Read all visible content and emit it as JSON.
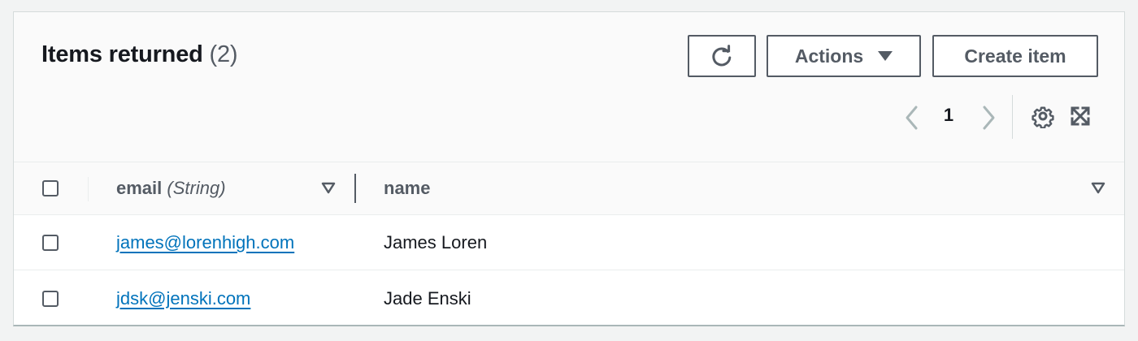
{
  "header": {
    "title": "Items returned",
    "count": "(2)"
  },
  "toolbar": {
    "refresh_icon": "refresh-icon",
    "actions_label": "Actions",
    "create_label": "Create item"
  },
  "pagination": {
    "current_page": "1",
    "prev_icon": "chevron-left-icon",
    "next_icon": "chevron-right-icon",
    "settings_icon": "gear-icon",
    "fullscreen_icon": "expand-icon"
  },
  "table": {
    "columns": [
      {
        "label": "email",
        "type": "(String)"
      },
      {
        "label": "name"
      }
    ],
    "rows": [
      {
        "email": "james@lorenhigh.com",
        "name": "James Loren"
      },
      {
        "email": "jdsk@jenski.com",
        "name": "Jade Enski"
      }
    ]
  },
  "colors": {
    "link": "#0073bb",
    "text": "#16191f",
    "secondary_text": "#545b64",
    "disabled": "#879596",
    "border": "#d5dbdb",
    "panel_bg": "#fafafa",
    "page_bg": "#f2f3f3"
  }
}
